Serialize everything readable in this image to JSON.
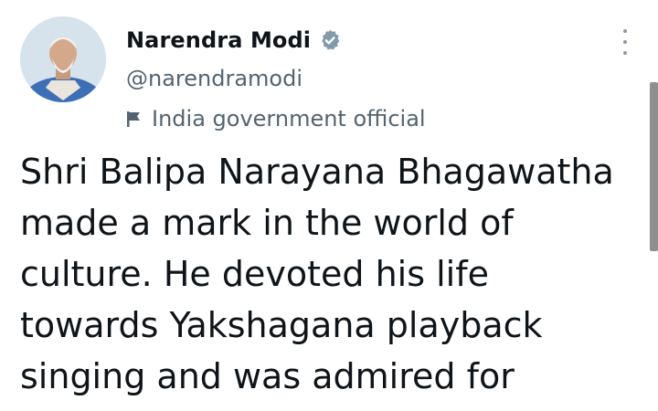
{
  "tweet": {
    "author": {
      "display_name": "Narendra Modi",
      "handle": "@narendramodi",
      "verified": true,
      "label_icon": "flag-icon",
      "label": "India government official",
      "avatar_icon": "profile-photo"
    },
    "more_icon": "more-vertical-icon",
    "text_lines": [
      "Shri Balipa Narayana Bhagawatha",
      "made a mark in the world of",
      "culture. He devoted his life",
      "towards Yakshagana playback",
      "singing and was admired for"
    ]
  },
  "colors": {
    "text_primary": "#0f1419",
    "text_secondary": "#536471",
    "verified_badge": "#829aab",
    "background": "#ffffff"
  }
}
